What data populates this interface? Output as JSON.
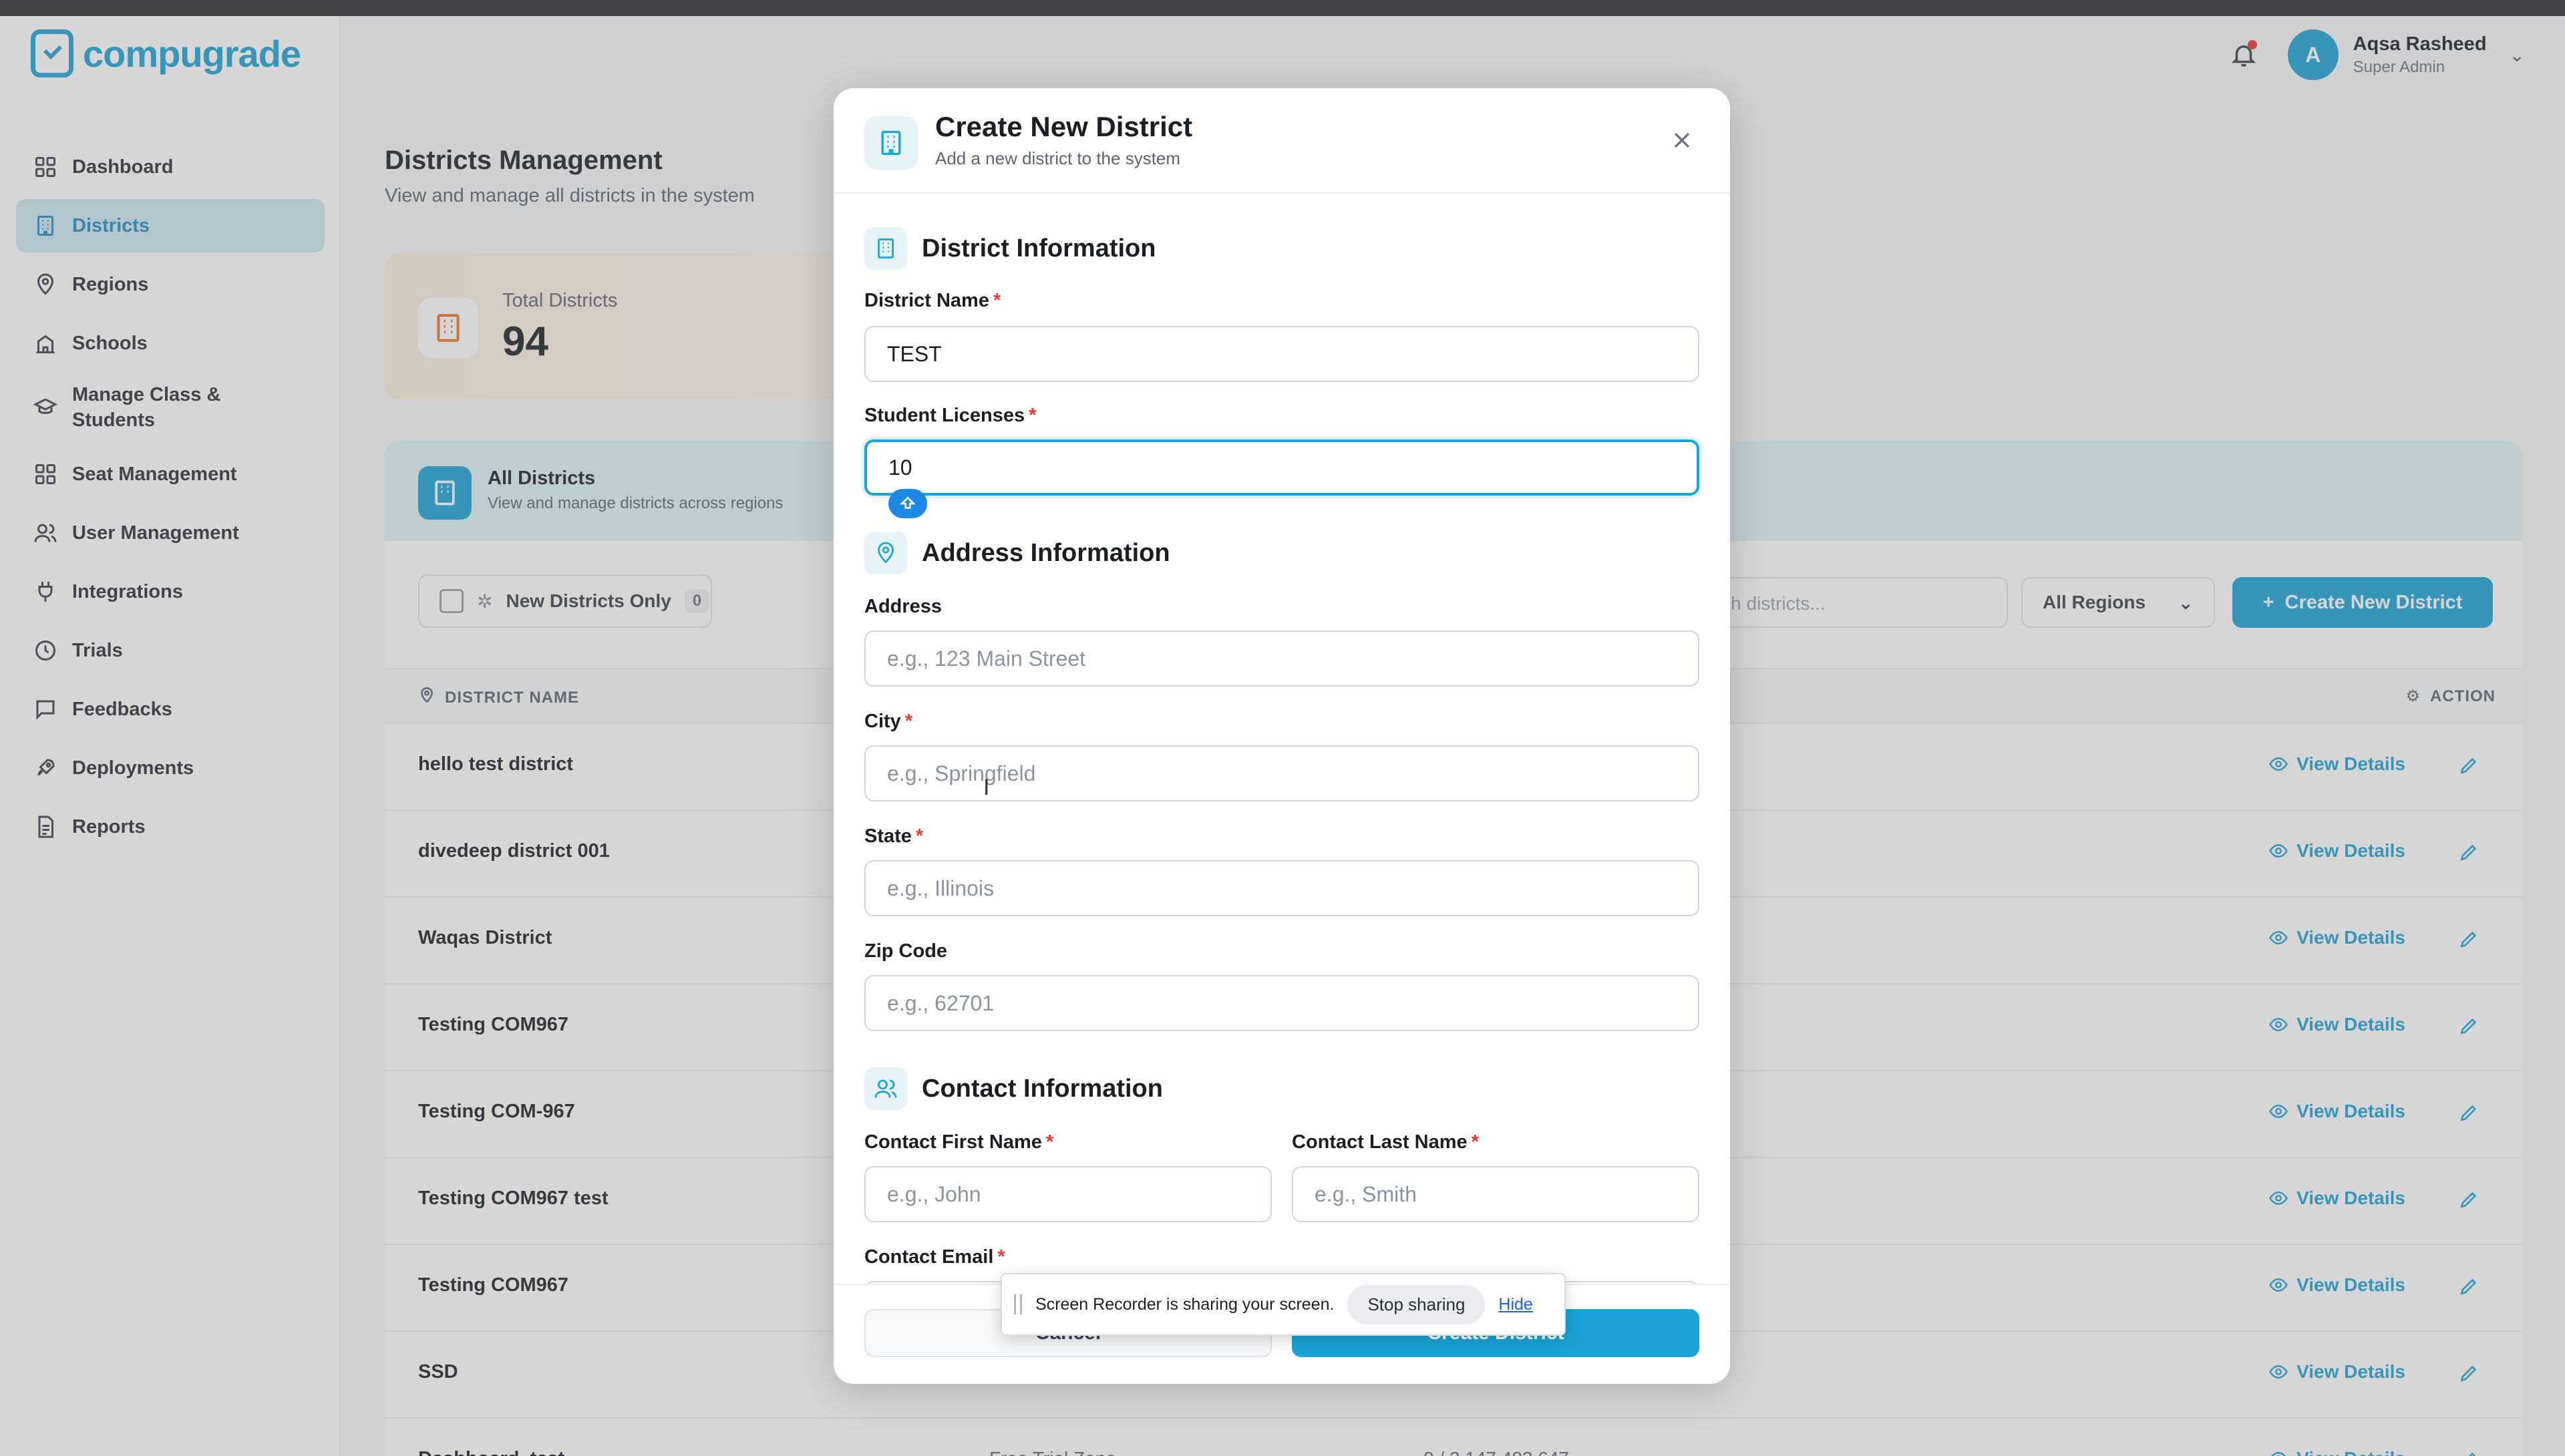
{
  "app": {
    "logo_text": "compugrade",
    "brand_color": "#1aa3d6"
  },
  "sidebar": {
    "items": [
      {
        "label": "Dashboard",
        "icon": "grid-icon",
        "active": false
      },
      {
        "label": "Districts",
        "icon": "building-icon",
        "active": true
      },
      {
        "label": "Regions",
        "icon": "map-pin-icon",
        "active": false
      },
      {
        "label": "Schools",
        "icon": "school-icon",
        "active": false
      },
      {
        "label": "Manage Class & Students",
        "icon": "graduation-cap-icon",
        "active": false
      },
      {
        "label": "Seat Management",
        "icon": "grid-icon",
        "active": false
      },
      {
        "label": "User Management",
        "icon": "users-icon",
        "active": false
      },
      {
        "label": "Integrations",
        "icon": "plug-icon",
        "active": false
      },
      {
        "label": "Trials",
        "icon": "clock-icon",
        "active": false
      },
      {
        "label": "Feedbacks",
        "icon": "message-icon",
        "active": false
      },
      {
        "label": "Deployments",
        "icon": "rocket-icon",
        "active": false
      },
      {
        "label": "Reports",
        "icon": "document-icon",
        "active": false
      }
    ]
  },
  "header": {
    "user": {
      "initial": "A",
      "name": "Aqsa Rasheed",
      "role": "Super Admin"
    }
  },
  "main": {
    "title": "Districts Management",
    "subtitle": "View and manage all districts in the system",
    "stat": {
      "label": "Total Districts",
      "value": "94"
    },
    "table": {
      "title": "All Districts",
      "subtitle": "View and manage districts across regions",
      "filter_label": "New Districts Only",
      "filter_count": "0",
      "search_placeholder": "Search districts...",
      "region_select": "All Regions",
      "create_button": "Create New District",
      "col_name": "DISTRICT NAME",
      "col_action": "ACTION",
      "view_label": "View Details",
      "rows": [
        {
          "name": "hello test district",
          "mid": "",
          "lic": ""
        },
        {
          "name": "divedeep district 001",
          "mid": "",
          "lic": ""
        },
        {
          "name": "Waqas District",
          "mid": "",
          "lic": ""
        },
        {
          "name": "Testing COM967",
          "mid": "",
          "lic": ""
        },
        {
          "name": "Testing COM-967",
          "mid": "",
          "lic": ""
        },
        {
          "name": "Testing COM967 test",
          "mid": "",
          "lic": ""
        },
        {
          "name": "Testing COM967",
          "mid": "",
          "lic": ""
        },
        {
          "name": "SSD",
          "mid": "",
          "lic": ""
        },
        {
          "name": "Dashboard_test",
          "mid": "Free Trial Zone",
          "lic": "0 / 2,147,483,647"
        }
      ]
    }
  },
  "modal": {
    "title": "Create New District",
    "subtitle": "Add a new district to the system",
    "sections": {
      "district": "District Information",
      "address": "Address Information",
      "contact": "Contact Information"
    },
    "fields": {
      "district_name": {
        "label": "District Name",
        "value": "TEST",
        "required": true
      },
      "student_licenses": {
        "label": "Student Licenses",
        "value": "10",
        "required": true
      },
      "address": {
        "label": "Address",
        "placeholder": "e.g., 123 Main Street",
        "required": false
      },
      "city": {
        "label": "City",
        "placeholder": "e.g., Springfield",
        "required": true
      },
      "state": {
        "label": "State",
        "placeholder": "e.g., Illinois",
        "required": true
      },
      "zip": {
        "label": "Zip Code",
        "placeholder": "e.g., 62701",
        "required": false
      },
      "first_name": {
        "label": "Contact First Name",
        "placeholder": "e.g., John",
        "required": true
      },
      "last_name": {
        "label": "Contact Last Name",
        "placeholder": "e.g., Smith",
        "required": true
      },
      "email": {
        "label": "Contact Email",
        "required": true
      }
    },
    "cancel_label": "Cancel",
    "submit_label": "Create District"
  },
  "share_bar": {
    "message": "Screen Recorder is sharing your screen.",
    "stop_label": "Stop sharing",
    "hide_label": "Hide"
  }
}
